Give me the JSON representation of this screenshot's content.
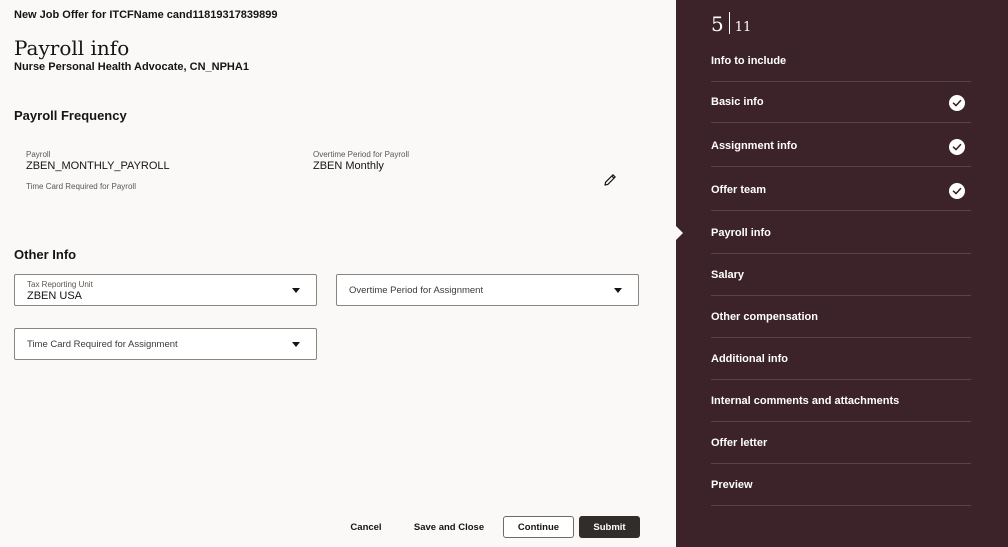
{
  "header": {
    "job_title": "New Job Offer for ITCFName cand11819317839899",
    "page_title": "Payroll info",
    "page_subtitle": "Nurse Personal Health Advocate, CN_NPHA1"
  },
  "payroll_frequency": {
    "title": "Payroll Frequency",
    "payroll_label": "Payroll",
    "payroll_value": "ZBEN_MONTHLY_PAYROLL",
    "overtime_label": "Overtime Period for Payroll",
    "overtime_value": "ZBEN Monthly",
    "timecard_label": "Time Card Required for Payroll",
    "edit_icon": "pencil-icon"
  },
  "other_info": {
    "title": "Other Info",
    "tax_unit_label": "Tax Reporting Unit",
    "tax_unit_value": "ZBEN USA",
    "overtime_assignment_placeholder": "Overtime Period for Assignment",
    "timecard_assignment_placeholder": "Time Card Required for Assignment"
  },
  "footer": {
    "cancel": "Cancel",
    "save_close": "Save and Close",
    "continue": "Continue",
    "submit": "Submit"
  },
  "sidebar": {
    "current_step": "5",
    "total_steps": "11",
    "items": [
      {
        "label": "Info to include",
        "completed": false,
        "current": false
      },
      {
        "label": "Basic info",
        "completed": true,
        "current": false
      },
      {
        "label": "Assignment info",
        "completed": true,
        "current": false
      },
      {
        "label": "Offer team",
        "completed": true,
        "current": false
      },
      {
        "label": "Payroll info",
        "completed": false,
        "current": true
      },
      {
        "label": "Salary",
        "completed": false,
        "current": false
      },
      {
        "label": "Other compensation",
        "completed": false,
        "current": false
      },
      {
        "label": "Additional info",
        "completed": false,
        "current": false
      },
      {
        "label": "Internal comments and attachments",
        "completed": false,
        "current": false
      },
      {
        "label": "Offer letter",
        "completed": false,
        "current": false
      },
      {
        "label": "Preview",
        "completed": false,
        "current": false
      }
    ]
  },
  "colors": {
    "sidebar_bg": "#3c2329",
    "page_bg": "#fbf9f8",
    "primary_button": "#312d2a"
  }
}
